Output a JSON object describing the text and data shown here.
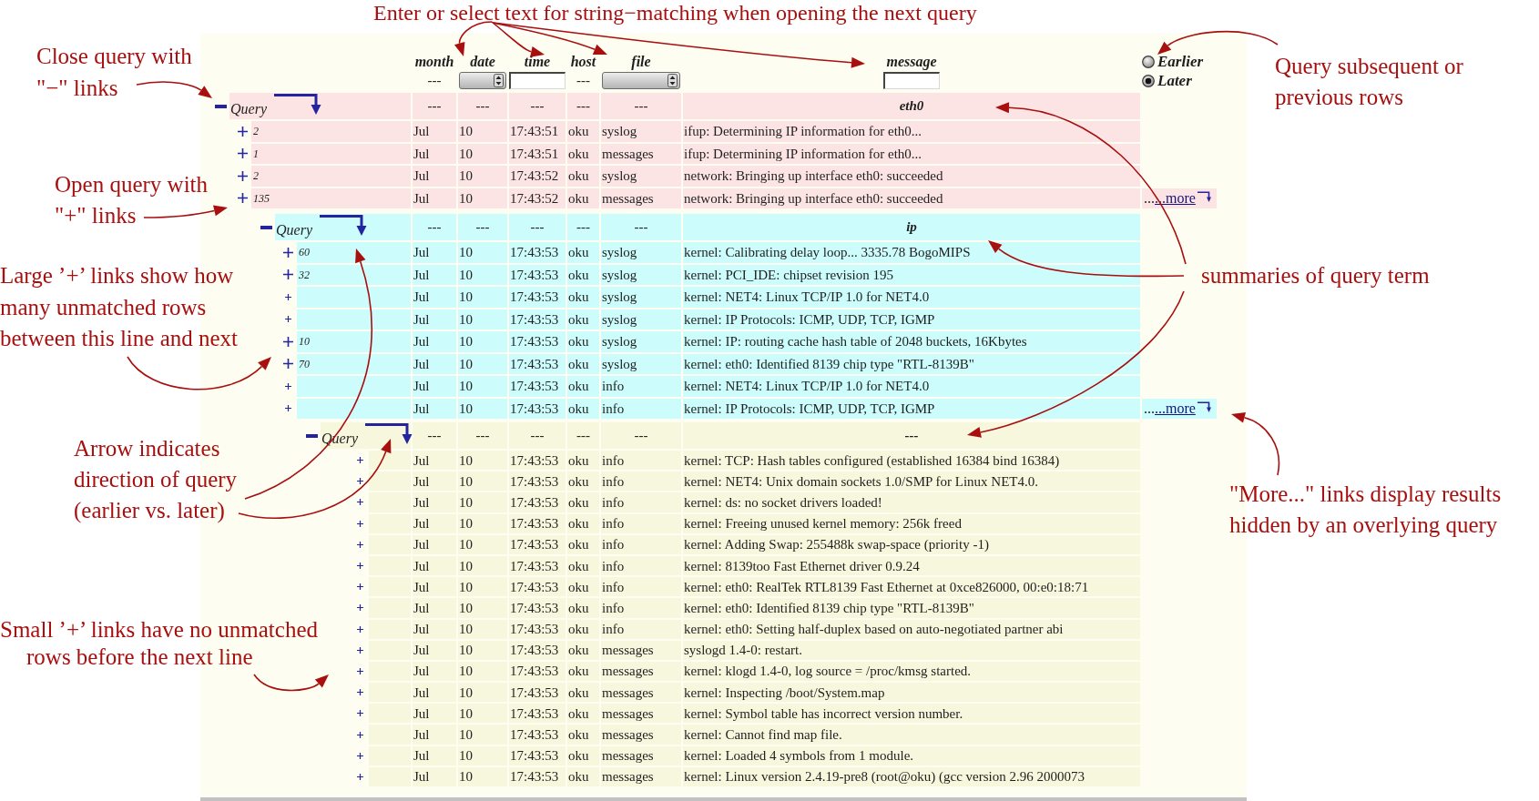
{
  "annotations": [
    {
      "lines": [
        "Enter or select text for string−matching when opening the next query"
      ]
    },
    {
      "lines": [
        "Close query with",
        "\"−\" links"
      ]
    },
    {
      "lines": [
        "Open query with",
        "\"+\" links"
      ]
    },
    {
      "lines": [
        "Large ’+’ links show how",
        "many unmatched rows",
        "between this line and next"
      ]
    },
    {
      "lines": [
        "Arrow indicates",
        "direction of query",
        "(earlier vs. later)"
      ]
    },
    {
      "lines": [
        "Small ’+’ links have no unmatched",
        "rows before the next line"
      ]
    },
    {
      "lines": [
        "Query subsequent or",
        "previous rows"
      ]
    },
    {
      "lines": [
        "summaries of query term"
      ]
    },
    {
      "lines": [
        "\"More...\" links display results",
        "hidden by an overlying query"
      ]
    }
  ],
  "query_form": {
    "columns": [
      {
        "label": "month",
        "field": {
          "kind": "static",
          "value": "---"
        }
      },
      {
        "label": "date",
        "field": {
          "kind": "select"
        }
      },
      {
        "label": "time",
        "field": {
          "kind": "text"
        }
      },
      {
        "label": "host",
        "field": {
          "kind": "static",
          "value": "---"
        }
      },
      {
        "label": "file",
        "field": {
          "kind": "select"
        }
      },
      {
        "label": "message",
        "field": {
          "kind": "text"
        }
      }
    ],
    "direction": [
      {
        "label": "Earlier",
        "selected": false
      },
      {
        "label": "Later",
        "selected": true
      }
    ]
  },
  "queries": [
    {
      "label": "Query",
      "arrow_down": true,
      "color": "#fce4e4",
      "summary": [
        "---",
        "---",
        "---",
        "---",
        "---",
        "eth0"
      ],
      "rows": [
        {
          "count": "2",
          "month": "Jul",
          "date": "10",
          "time": "17:43:51",
          "host": "oku",
          "file": "syslog",
          "message": "ifup: Determining IP information for eth0..."
        },
        {
          "count": "1",
          "month": "Jul",
          "date": "10",
          "time": "17:43:51",
          "host": "oku",
          "file": "messages",
          "message": "ifup: Determining IP information for eth0..."
        },
        {
          "count": "2",
          "month": "Jul",
          "date": "10",
          "time": "17:43:52",
          "host": "oku",
          "file": "syslog",
          "message": "network: Bringing up interface eth0: succeeded"
        },
        {
          "count": "135",
          "month": "Jul",
          "date": "10",
          "time": "17:43:52",
          "host": "oku",
          "file": "messages",
          "message": "network: Bringing up interface eth0: succeeded"
        }
      ],
      "more": {
        "dots": "...",
        "link": "...more"
      }
    },
    {
      "label": "Query",
      "arrow_down": true,
      "color": "#ccfcfc",
      "summary": [
        "---",
        "---",
        "---",
        "---",
        "---",
        "ip"
      ],
      "rows": [
        {
          "count": "60",
          "month": "Jul",
          "date": "10",
          "time": "17:43:53",
          "host": "oku",
          "file": "syslog",
          "message": "kernel: Calibrating delay loop... 3335.78 BogoMIPS"
        },
        {
          "count": "32",
          "month": "Jul",
          "date": "10",
          "time": "17:43:53",
          "host": "oku",
          "file": "syslog",
          "message": "kernel: PCI_IDE: chipset revision 195"
        },
        {
          "month": "Jul",
          "date": "10",
          "time": "17:43:53",
          "host": "oku",
          "file": "syslog",
          "message": "kernel: NET4: Linux TCP/IP 1.0 for NET4.0"
        },
        {
          "month": "Jul",
          "date": "10",
          "time": "17:43:53",
          "host": "oku",
          "file": "syslog",
          "message": "kernel: IP Protocols: ICMP, UDP, TCP, IGMP"
        },
        {
          "count": "10",
          "month": "Jul",
          "date": "10",
          "time": "17:43:53",
          "host": "oku",
          "file": "syslog",
          "message": "kernel: IP: routing cache hash table of 2048 buckets, 16Kbytes"
        },
        {
          "count": "70",
          "month": "Jul",
          "date": "10",
          "time": "17:43:53",
          "host": "oku",
          "file": "syslog",
          "message": "kernel: eth0: Identified 8139 chip type \"RTL-8139B\""
        },
        {
          "month": "Jul",
          "date": "10",
          "time": "17:43:53",
          "host": "oku",
          "file": "info",
          "message": "kernel: NET4: Linux TCP/IP 1.0 for NET4.0"
        },
        {
          "month": "Jul",
          "date": "10",
          "time": "17:43:53",
          "host": "oku",
          "file": "info",
          "message": "kernel: IP Protocols: ICMP, UDP, TCP, IGMP"
        }
      ],
      "more": {
        "dots": "...",
        "link": "...more"
      }
    },
    {
      "label": "Query",
      "arrow_down": true,
      "color": "#f7f7dd",
      "summary": [
        "---",
        "---",
        "---",
        "---",
        "---",
        "---"
      ],
      "rows": [
        {
          "month": "Jul",
          "date": "10",
          "time": "17:43:53",
          "host": "oku",
          "file": "info",
          "message": "kernel: TCP: Hash tables configured (established 16384 bind 16384)"
        },
        {
          "month": "Jul",
          "date": "10",
          "time": "17:43:53",
          "host": "oku",
          "file": "info",
          "message": "kernel: NET4: Unix domain sockets 1.0/SMP for Linux NET4.0."
        },
        {
          "month": "Jul",
          "date": "10",
          "time": "17:43:53",
          "host": "oku",
          "file": "info",
          "message": "kernel: ds: no socket drivers loaded!"
        },
        {
          "month": "Jul",
          "date": "10",
          "time": "17:43:53",
          "host": "oku",
          "file": "info",
          "message": "kernel: Freeing unused kernel memory: 256k freed"
        },
        {
          "month": "Jul",
          "date": "10",
          "time": "17:43:53",
          "host": "oku",
          "file": "info",
          "message": "kernel: Adding Swap: 255488k swap-space (priority -1)"
        },
        {
          "month": "Jul",
          "date": "10",
          "time": "17:43:53",
          "host": "oku",
          "file": "info",
          "message": "kernel: 8139too Fast Ethernet driver 0.9.24"
        },
        {
          "month": "Jul",
          "date": "10",
          "time": "17:43:53",
          "host": "oku",
          "file": "info",
          "message": "kernel: eth0: RealTek RTL8139 Fast Ethernet at 0xce826000, 00:e0:18:71"
        },
        {
          "month": "Jul",
          "date": "10",
          "time": "17:43:53",
          "host": "oku",
          "file": "info",
          "message": "kernel: eth0: Identified 8139 chip type \"RTL-8139B\""
        },
        {
          "month": "Jul",
          "date": "10",
          "time": "17:43:53",
          "host": "oku",
          "file": "info",
          "message": "kernel: eth0: Setting half-duplex based on auto-negotiated partner abi"
        },
        {
          "month": "Jul",
          "date": "10",
          "time": "17:43:53",
          "host": "oku",
          "file": "messages",
          "message": "syslogd 1.4-0: restart."
        },
        {
          "month": "Jul",
          "date": "10",
          "time": "17:43:53",
          "host": "oku",
          "file": "messages",
          "message": "kernel: klogd 1.4-0, log source = /proc/kmsg started."
        },
        {
          "month": "Jul",
          "date": "10",
          "time": "17:43:53",
          "host": "oku",
          "file": "messages",
          "message": "kernel: Inspecting /boot/System.map"
        },
        {
          "month": "Jul",
          "date": "10",
          "time": "17:43:53",
          "host": "oku",
          "file": "messages",
          "message": "kernel: Symbol table has incorrect version number."
        },
        {
          "month": "Jul",
          "date": "10",
          "time": "17:43:53",
          "host": "oku",
          "file": "messages",
          "message": "kernel: Cannot find map file."
        },
        {
          "month": "Jul",
          "date": "10",
          "time": "17:43:53",
          "host": "oku",
          "file": "messages",
          "message": "kernel: Loaded 4 symbols from 1 module."
        },
        {
          "month": "Jul",
          "date": "10",
          "time": "17:43:53",
          "host": "oku",
          "file": "messages",
          "message": "kernel: Linux version 2.4.19-pre8 (root@oku) (gcc version 2.96 2000073"
        }
      ]
    }
  ]
}
